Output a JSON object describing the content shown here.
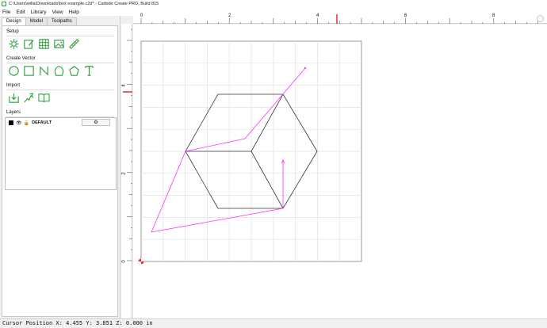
{
  "window": {
    "title": "C:\\Users\\willa\\Downloads\\box example.c2d* - Carbide Create PRO, Build 815"
  },
  "menu": [
    "File",
    "Edit",
    "Library",
    "View",
    "Help"
  ],
  "tabs": [
    "Design",
    "Model",
    "Toolpaths"
  ],
  "sections": {
    "setup": "Setup",
    "create_vector": "Create Vector",
    "import": "Import",
    "layers": "Layers"
  },
  "setup_tools": [
    "gear-icon",
    "edit-icon",
    "grid-icon",
    "image-icon",
    "ruler-icon"
  ],
  "vector_tools": [
    "circle-icon",
    "rectangle-icon",
    "curve-icon",
    "polygon-shape-icon",
    "pentagon-icon",
    "text-icon"
  ],
  "import_tools": [
    "import-icon",
    "trace-icon",
    "library-icon"
  ],
  "layer": {
    "name": "DEFAULT",
    "color": "#000000"
  },
  "ruler": {
    "h_labels": [
      "0",
      "2",
      "4",
      "6",
      "8"
    ],
    "v_labels": [
      "4",
      "2",
      "0"
    ]
  },
  "colors": {
    "accent": "#2e9e3a",
    "toolpath": "#ff33ff",
    "marker": "#e03030"
  },
  "status": {
    "text": "Cursor Position X: 4.455 Y: 3.851 Z: 0.000 in"
  }
}
